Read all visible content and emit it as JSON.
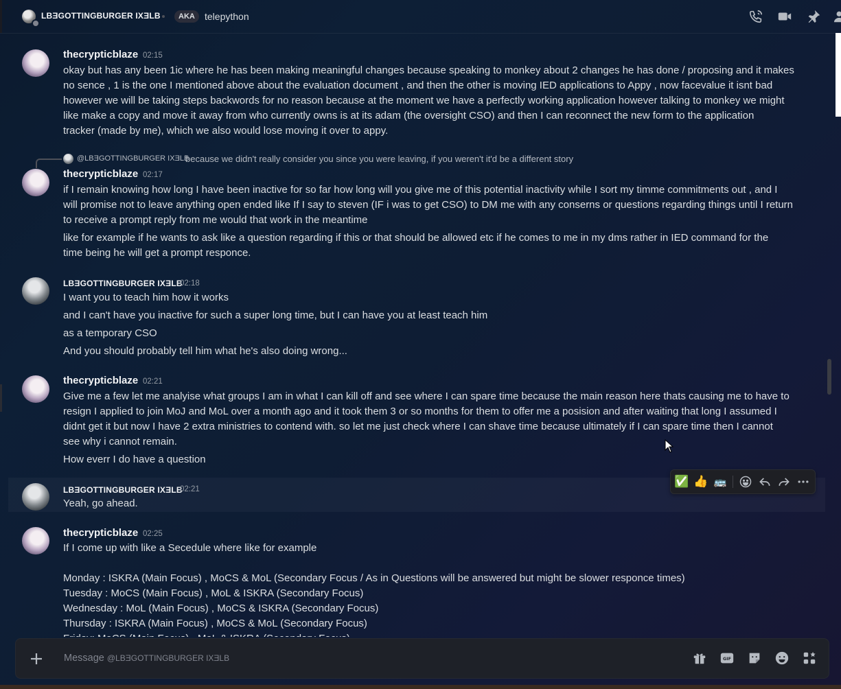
{
  "header": {
    "title": "LBƎGOTTINGBURGER IXƎLB",
    "aka_label": "AKA",
    "aka_name": "telepython",
    "icons": [
      "voice-call-icon",
      "video-call-icon",
      "pin-icon",
      "add-friend-icon"
    ]
  },
  "messages": [
    {
      "author": "thecrypticblaze",
      "time": "02:15",
      "lines": [
        "okay but has any been 1ic where he has been making meaningful changes because speaking to monkey about 2 changes he has done / proposing and it makes",
        "no sence , 1 is the one I mentioned above about the evaluation document , and then the other is moving IED applications to Appy , now facevalue it isnt bad",
        "however we will be taking steps backwords for no reason because at the moment we have a perfectly working application however talking to monkey we might",
        "like make a copy and move it away from who currently owns is at its adam (the oversight CSO) and then I can reconnect the new form to the application",
        "tracker (made by me), which we also would lose moving it over to appy."
      ]
    },
    {
      "reply_to_name": "@LBƎGOTTINGBURGER IXƎLB",
      "reply_to_text": "because we didn't really consider you since you were leaving, if you weren't it'd be a different story",
      "author": "thecrypticblaze",
      "time": "02:17",
      "lines": [
        "if I remain knowing how long I have been inactive for so far how long will you give me of this potential inactivity while I sort my timme commitments out , and I",
        "will promise not to leave anything open ended like If I say to steven (IF i was to get CSO) to DM me with any conserns or questions regarding things until I return",
        "to receive a prompt reply from me would that work in the meantime"
      ],
      "lines2": [
        "like for example if he wants to ask like a question regarding if this or that should be allowed etc if he comes to me in my dms rather in IED command for the",
        "time being he will get a prompt responce."
      ]
    },
    {
      "author": "LBƎGOTTINGBURGER IXƎLB",
      "time": "02:18",
      "lines": [
        "I want you to teach him how it works",
        "and I can't have you inactive for such a super long time, but I can have you at least teach him",
        "as a temporary CSO",
        "And you should probably tell him what he's also doing wrong..."
      ]
    },
    {
      "author": "thecrypticblaze",
      "time": "02:21",
      "lines": [
        "Give me a few let me analyise what groups I am in what I can kill off and see where I can spare time because the main reason here thats causing me to have to",
        "resign I applied to join MoJ and MoL over a month ago and it took them 3 or so months for them to offer me a posision and after waiting that long I assumed I",
        "didnt get it but now I have 2 extra ministries to contend with. so let me just check where I can shave time because ultimately if I can spare time then I cannot",
        "see why i cannot remain."
      ],
      "lines2": [
        "How everr I do have a question"
      ]
    },
    {
      "author": "LBƎGOTTINGBURGER IXƎLB",
      "time": "02:21",
      "lines": [
        "Yeah, go ahead."
      ]
    },
    {
      "author": "thecrypticblaze",
      "time": "02:25",
      "lines": [
        "If I come up with like a Secedule where like for example",
        "",
        "Monday : ISKRA (Main Focus) , MoCS & MoL (Secondary Focus / As in Questions will be answered but might be slower responce times)",
        "Tuesday : MoCS (Main Focus) , MoL & ISKRA (Secondary Focus)",
        "Wednesday : MoL (Main Focus) , MoCS & ISKRA (Secondary Focus)",
        "Thursday : ISKRA (Main Focus) , MoCS & MoL (Secondary Focus)",
        "Friday: MoCS (Main Focus) , MoL & ISKRA (Secondary Focus)"
      ]
    }
  ],
  "hover_toolbar": {
    "reactions": [
      "✅",
      "👍",
      "🚌"
    ],
    "actions": [
      "add-reaction-icon",
      "reply-icon",
      "forward-icon",
      "more-icon"
    ]
  },
  "composer": {
    "placeholder_prefix": "Message ",
    "placeholder_name": "@LBƎGOTTINGBURGER IXƎLB",
    "icons": [
      "gift-icon",
      "gif-icon",
      "sticker-icon",
      "emoji-icon",
      "apps-icon"
    ]
  },
  "colors": {
    "accent": "#5865f2",
    "text": "#dbdee1",
    "muted": "#949ba4"
  }
}
